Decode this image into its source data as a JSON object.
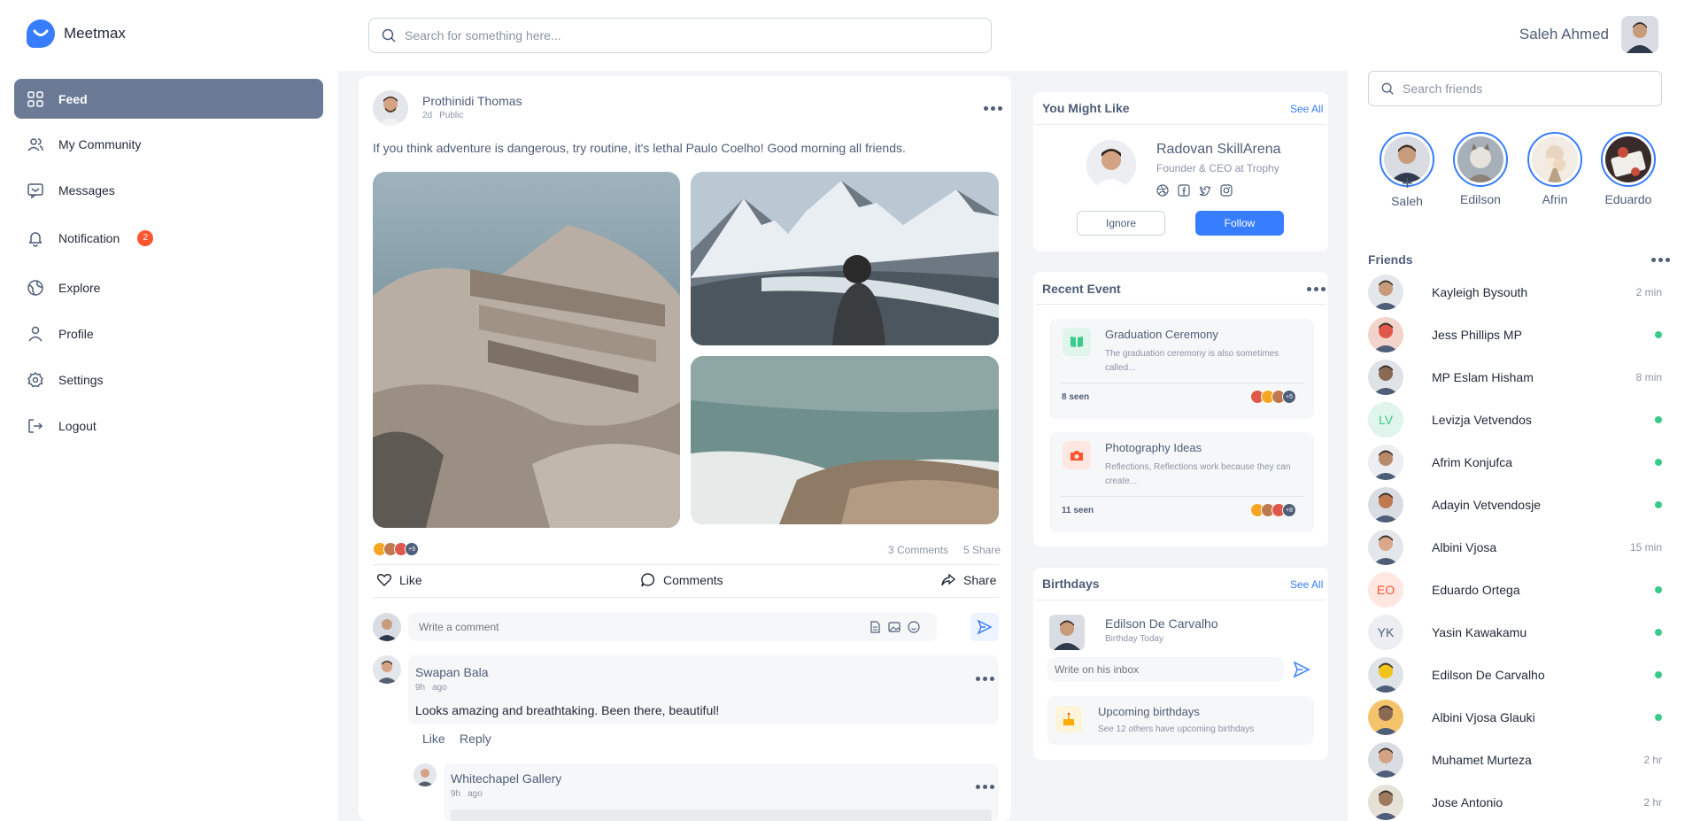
{
  "app": {
    "name": "Meetmax"
  },
  "search": {
    "placeholder": "Search for something here..."
  },
  "user": {
    "name": "Saleh Ahmed"
  },
  "sidebar": {
    "items": [
      {
        "label": "Feed",
        "icon": "grid-icon",
        "active": true
      },
      {
        "label": "My Community",
        "icon": "users-icon"
      },
      {
        "label": "Messages",
        "icon": "message-icon"
      },
      {
        "label": "Notification",
        "icon": "bell-icon",
        "badge": "2"
      },
      {
        "label": "Explore",
        "icon": "globe-icon"
      },
      {
        "label": "Profile",
        "icon": "user-icon"
      },
      {
        "label": "Settings",
        "icon": "gear-icon"
      },
      {
        "label": "Logout",
        "icon": "logout-icon"
      }
    ]
  },
  "post": {
    "author": "Prothinidi Thomas",
    "time": "2d",
    "visibility": "Public",
    "text": "If you think adventure is dangerous, try routine, it's lethal Paulo Coelho! Good morning all friends.",
    "likes_more": "+9",
    "comments_count": "3 Comments",
    "share_count": "5 Share",
    "actions": {
      "like": "Like",
      "comments": "Comments",
      "share": "Share"
    },
    "comment_placeholder": "Write a comment",
    "comments": [
      {
        "author": "Swapan Bala",
        "time": "9h",
        "ago": "ago",
        "text": "Looks amazing and breathtaking. Been there, beautiful!",
        "like": "Like",
        "reply": "Reply"
      },
      {
        "author": "Whitechapel Gallery",
        "time": "9h",
        "ago": "ago"
      }
    ]
  },
  "suggest": {
    "title": "You Might Like",
    "see_all": "See All",
    "name": "Radovan SkillArena",
    "role": "Founder & CEO at Trophy",
    "ignore": "Ignore",
    "follow": "Follow"
  },
  "events": {
    "title": "Recent Event",
    "items": [
      {
        "title": "Graduation Ceremony",
        "desc": "The graduation ceremony is also sometimes called...",
        "seen": "8 seen",
        "more": "+5",
        "icon": "book-icon",
        "color": "#38cb89"
      },
      {
        "title": "Photography Ideas",
        "desc": "Reflections, Reflections work because they can create...",
        "seen": "11 seen",
        "more": "+8",
        "icon": "camera-icon",
        "color": "#ff5630"
      }
    ]
  },
  "birthdays": {
    "title": "Birthdays",
    "see_all": "See All",
    "name": "Edilson De Carvalho",
    "sub": "Birthday Today",
    "inbox_placeholder": "Write on his inbox",
    "upcoming_title": "Upcoming birthdays",
    "upcoming_sub": "See 12 others have upcoming birthdays"
  },
  "friends_panel": {
    "search_placeholder": "Search friends",
    "stories": [
      {
        "name": "Saleh"
      },
      {
        "name": "Edilson"
      },
      {
        "name": "Afrin"
      },
      {
        "name": "Eduardo"
      }
    ],
    "title": "Friends",
    "list": [
      {
        "name": "Kayleigh Bysouth",
        "status": "2 min"
      },
      {
        "name": "Jess Phillips MP",
        "status": "online"
      },
      {
        "name": "MP Eslam Hisham",
        "status": "8 min"
      },
      {
        "name": "Levizja Vetvendos",
        "status": "online",
        "initials": "LV",
        "bg": "#e0f5ec",
        "fg": "#38cb89"
      },
      {
        "name": "Afrim Konjufca",
        "status": "online"
      },
      {
        "name": "Adayin Vetvendosje",
        "status": "online"
      },
      {
        "name": "Albini Vjosa",
        "status": "15 min"
      },
      {
        "name": "Eduardo Ortega",
        "status": "online",
        "initials": "EO",
        "bg": "#ffe7e1",
        "fg": "#ff5630"
      },
      {
        "name": "Yasin Kawakamu",
        "status": "online",
        "initials": "YK",
        "bg": "#eceef2",
        "fg": "#4e5d78"
      },
      {
        "name": "Edilson De Carvalho",
        "status": "online"
      },
      {
        "name": "Albini Vjosa Glauki",
        "status": "online"
      },
      {
        "name": "Muhamet Murteza",
        "status": "2 hr"
      },
      {
        "name": "Jose Antonio",
        "status": "2 hr"
      }
    ]
  }
}
